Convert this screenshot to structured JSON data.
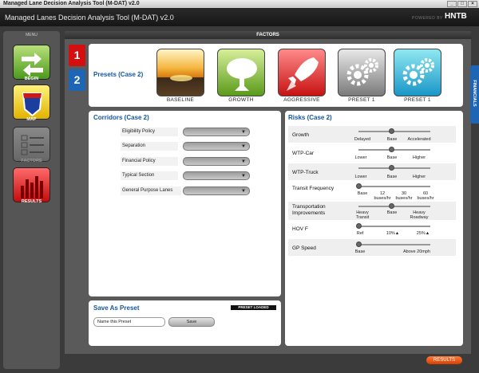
{
  "window": {
    "title": "Managed Lane Decision Analysis Tool (M-DAT) v2.0",
    "min": "_",
    "max": "□",
    "close": "×"
  },
  "header": {
    "app_title": "Managed Lanes Decision Analysis Tool (M-DAT) v2.0",
    "powered_by": "POWERED BY",
    "brand": "HNTB"
  },
  "menu": {
    "title": "MENU",
    "items": [
      {
        "label": "BEGIN",
        "icon": "arrows-icon"
      },
      {
        "label": "MAP",
        "icon": "interstate-shield-icon"
      },
      {
        "label": "FACTORS",
        "icon": "checklist-icon"
      },
      {
        "label": "RESULTS",
        "icon": "bar-chart-icon"
      }
    ]
  },
  "factors_header": "FACTORS",
  "steps": [
    "1",
    "2"
  ],
  "presets": {
    "title": "Presets (Case 2)",
    "items": [
      {
        "label": "BASELINE",
        "icon": "sunset-icon"
      },
      {
        "label": "GROWTH",
        "icon": "tree-icon"
      },
      {
        "label": "AGGRESSIVE",
        "icon": "rocket-icon"
      },
      {
        "label": "PRESET 1",
        "icon": "gears-icon"
      },
      {
        "label": "PRESET 1",
        "icon": "gears-icon"
      }
    ]
  },
  "corridors": {
    "title": "Corridors (Case 2)",
    "fields": [
      "Eligibility Policy",
      "Separation",
      "Financial Policy",
      "Typical Section",
      "General Purpose Lanes"
    ]
  },
  "risks": {
    "title": "Risks (Case 2)",
    "rows": [
      {
        "label": "Growth",
        "ticks": [
          "Delayed",
          "Base",
          "Accelerated"
        ],
        "value": 0.5
      },
      {
        "label": "WTP-Car",
        "ticks": [
          "Lower",
          "Base",
          "Higher"
        ],
        "value": 0.5
      },
      {
        "label": "WTP-Truck",
        "ticks": [
          "Lower",
          "Base",
          "Higher"
        ],
        "value": 0.5
      },
      {
        "label": "Transit Frequency",
        "ticks": [
          "Base",
          "12 buses/hr",
          "30 buses/hr",
          "60 buses/hr"
        ],
        "value": 0
      },
      {
        "label": "Transportation Improvements",
        "ticks": [
          "Heavy Transit",
          "Base",
          "Heavy Roadway"
        ],
        "value": 0.5
      },
      {
        "label": "HOV F",
        "ticks": [
          "Ref",
          "10%▲",
          "25%▲"
        ],
        "value": 0
      },
      {
        "label": "GP Speed",
        "ticks": [
          "Base",
          "Above 20mph"
        ],
        "value": 0
      }
    ]
  },
  "save_preset": {
    "title": "Save As Preset",
    "status": "PRESET LOADED",
    "input_value": "Name this Preset",
    "save_label": "Save"
  },
  "side_tab": "FINANCIALS",
  "footer": {
    "results_label": "RESULTS"
  },
  "colors": {
    "accent_blue": "#14569c",
    "step_red": "#d30f0f",
    "step_blue": "#1d65b5",
    "results_orange": "#e95a14"
  }
}
